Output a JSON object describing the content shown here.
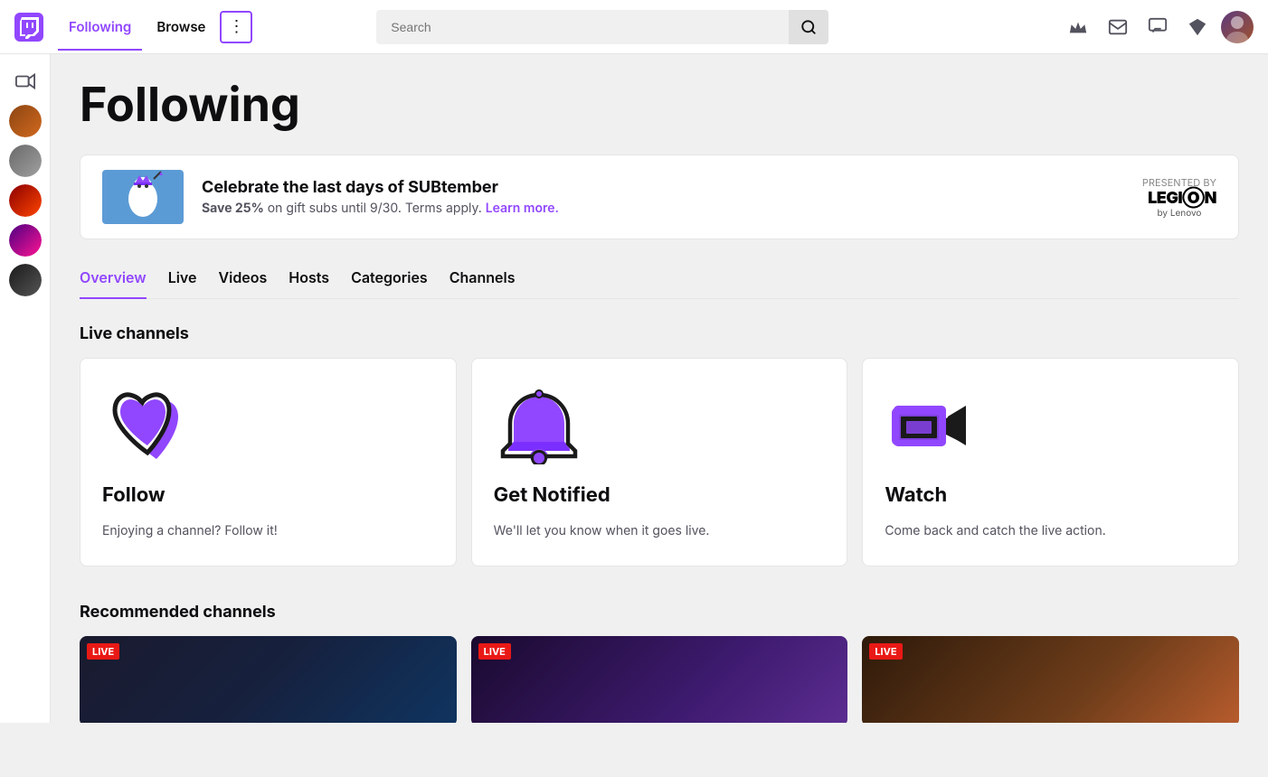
{
  "topnav": {
    "logo_label": "Twitch",
    "nav_links": [
      {
        "id": "following",
        "label": "Following",
        "active": true
      },
      {
        "id": "browse",
        "label": "Browse",
        "active": false
      }
    ],
    "more_button_label": "⋮",
    "search": {
      "placeholder": "Search",
      "value": ""
    },
    "icons": {
      "crown": "👑",
      "mail": "✉",
      "chat": "💬",
      "gem": "◆"
    }
  },
  "sidebar": {
    "video_icon": "📷",
    "avatars": [
      {
        "id": "av1",
        "label": "User 1"
      },
      {
        "id": "av2",
        "label": "User 2"
      },
      {
        "id": "av3",
        "label": "User 3"
      },
      {
        "id": "av4",
        "label": "User 4"
      },
      {
        "id": "av5",
        "label": "User 5"
      }
    ]
  },
  "main": {
    "page_title": "Following",
    "banner": {
      "icon": "🎭",
      "heading": "Celebrate the last days of SUBtember",
      "body_prefix": "Save 25%",
      "body_suffix": " on gift subs until 9/30. Terms apply.",
      "link_text": "Learn more.",
      "sponsor_prefix": "PRESENTED BY",
      "sponsor_name": "LEGIⓄN",
      "sponsor_sub": "by Lenovo"
    },
    "tabs": [
      {
        "id": "overview",
        "label": "Overview",
        "active": true
      },
      {
        "id": "live",
        "label": "Live",
        "active": false
      },
      {
        "id": "videos",
        "label": "Videos",
        "active": false
      },
      {
        "id": "hosts",
        "label": "Hosts",
        "active": false
      },
      {
        "id": "categories",
        "label": "Categories",
        "active": false
      },
      {
        "id": "channels",
        "label": "Channels",
        "active": false
      }
    ],
    "live_channels_title": "Live channels",
    "cards": [
      {
        "id": "follow",
        "title": "Follow",
        "description": "Enjoying a channel? Follow it!"
      },
      {
        "id": "get-notified",
        "title": "Get Notified",
        "description": "We'll let you know when it goes live."
      },
      {
        "id": "watch",
        "title": "Watch",
        "description": "Come back and catch the live action."
      }
    ],
    "recommended_title": "Recommended channels",
    "live_badge": "LIVE"
  }
}
